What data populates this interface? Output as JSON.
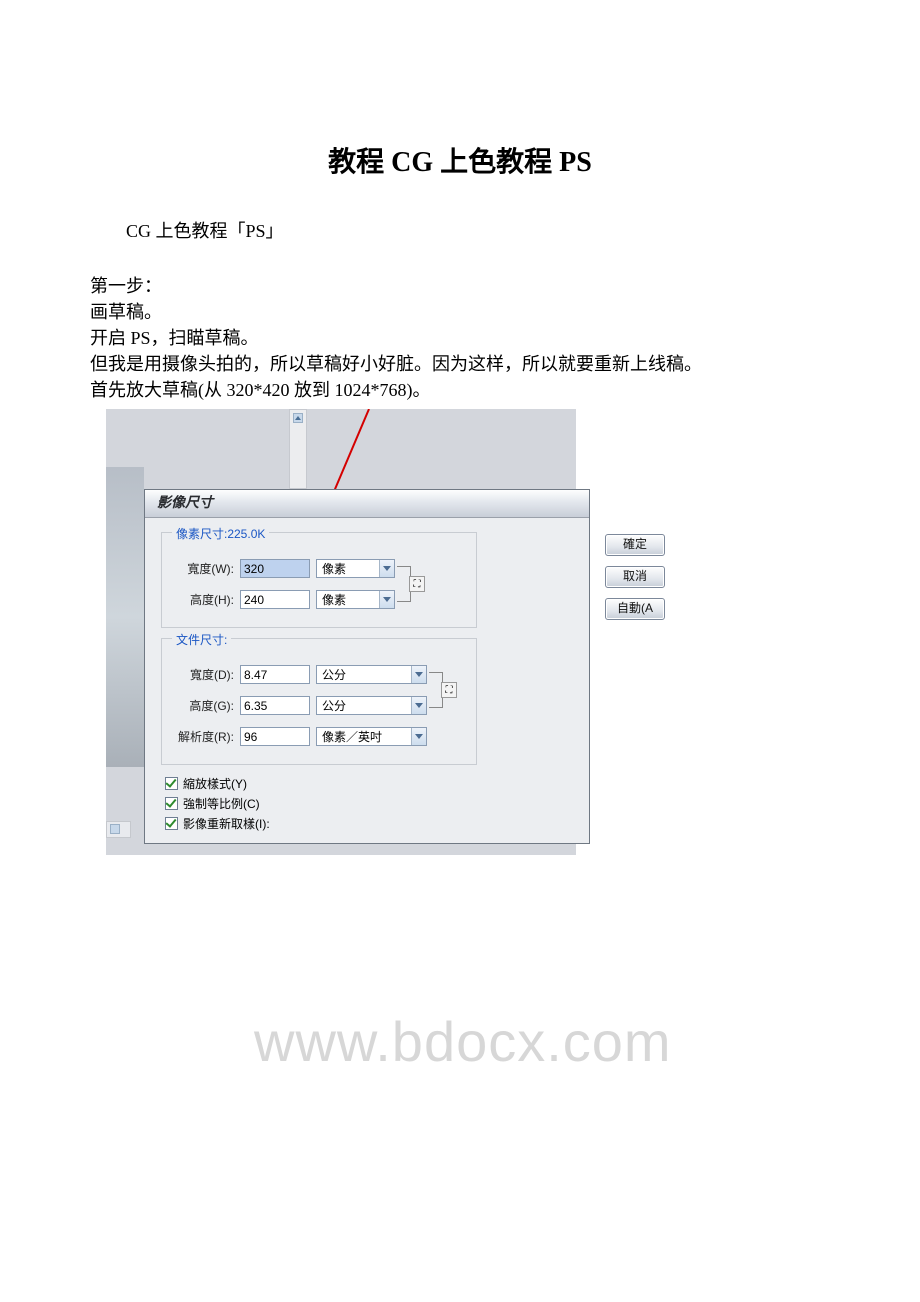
{
  "doc": {
    "title": "教程 CG 上色教程 PS",
    "subtitle": "CG 上色教程「PS」",
    "p1": "第一步：",
    "p2": "画草稿。",
    "p3": "开启 PS，扫瞄草稿。",
    "p4": "但我是用摄像头拍的，所以草稿好小好脏。因为这样，所以就要重新上线稿。",
    "p5": "首先放大草稿(从 320*420 放到 1024*768)。"
  },
  "dialog": {
    "title": "影像尺寸",
    "pixel_legend": "像素尺寸:225.0K",
    "width_w_label": "寬度(W):",
    "width_w_value": "320",
    "height_h_label": "高度(H):",
    "height_h_value": "240",
    "unit_px": "像素",
    "doc_legend": "文件尺寸:",
    "width_d_label": "寬度(D):",
    "width_d_value": "8.47",
    "height_g_label": "高度(G):",
    "height_g_value": "6.35",
    "unit_cm": "公分",
    "res_label": "解析度(R):",
    "res_value": "96",
    "unit_ppi": "像素／英吋",
    "btn_ok": "確定",
    "btn_cancel": "取消",
    "btn_auto": "自動(A",
    "chk_scale": "縮放樣式(Y)",
    "chk_constrain": "強制等比例(C)",
    "chk_resample": "影像重新取樣(I):"
  },
  "watermark": "www.bdocx.com"
}
